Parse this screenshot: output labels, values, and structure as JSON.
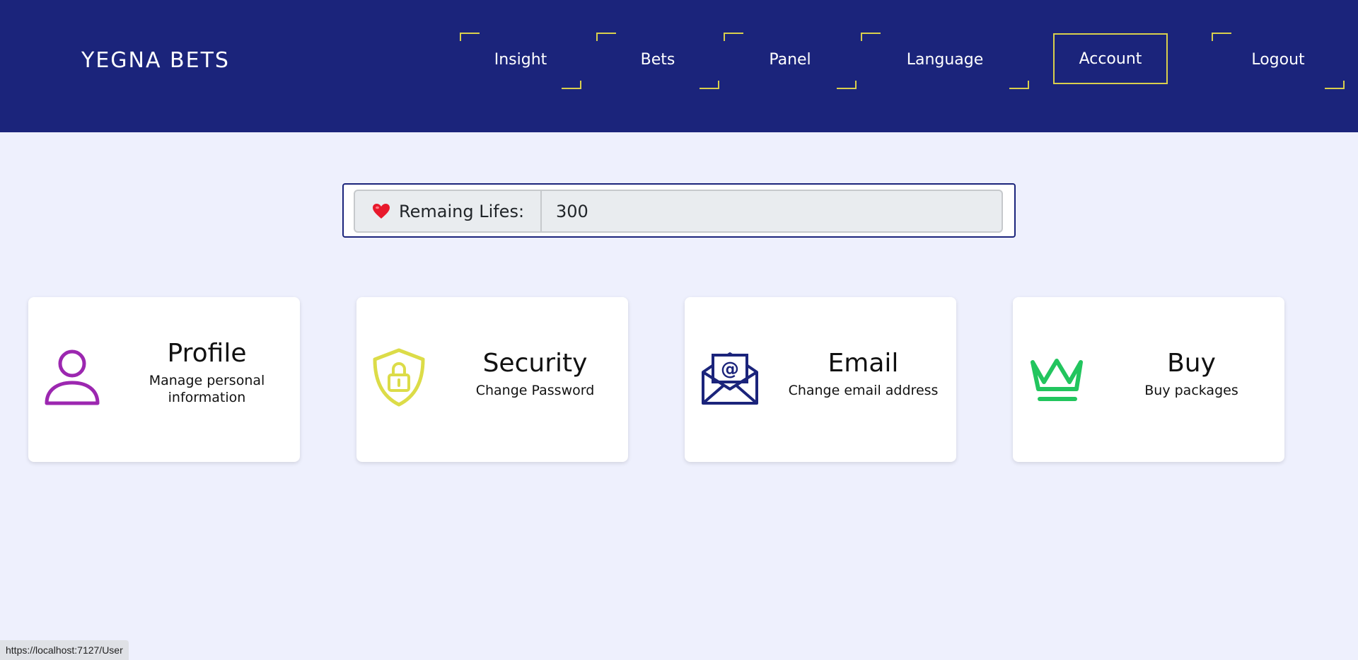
{
  "brand": "YEGNA BETS",
  "nav": {
    "insight": "Insight",
    "bets": "Bets",
    "panel": "Panel",
    "language": "Language",
    "account": "Account",
    "logout": "Logout"
  },
  "lives": {
    "label": "Remaing Lifes:",
    "value": "300",
    "icon": "heart-icon"
  },
  "cards": [
    {
      "title": "Profile",
      "subtitle": "Manage personal information",
      "icon": "person-icon",
      "color": "#9c27b0"
    },
    {
      "title": "Security",
      "subtitle": "Change Password",
      "icon": "shield-lock-icon",
      "color": "#dcdc48"
    },
    {
      "title": "Email",
      "subtitle": "Change email address",
      "icon": "envelope-at-icon",
      "color": "#1b247b"
    },
    {
      "title": "Buy",
      "subtitle": "Buy packages",
      "icon": "crown-icon",
      "color": "#22c55e"
    }
  ],
  "status_url": "https://localhost:7127/User",
  "colors": {
    "navbar": "#1b247b",
    "accent": "#d9cf4c",
    "background": "#eef0fd"
  }
}
